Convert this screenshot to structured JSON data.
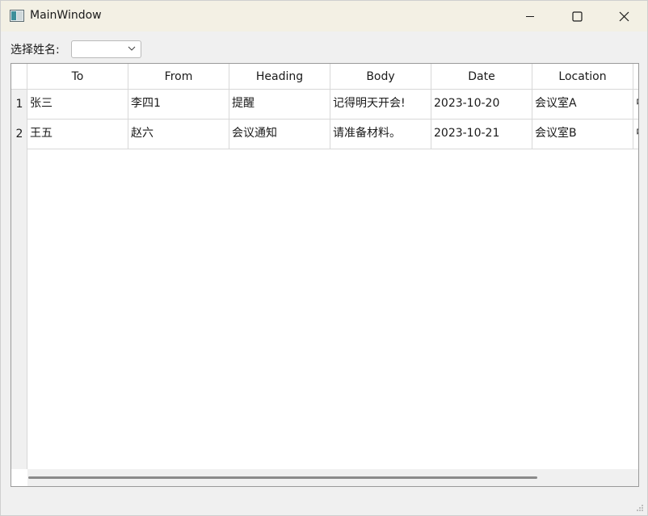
{
  "window": {
    "title": "MainWindow"
  },
  "filter": {
    "label": "选择姓名:",
    "selected": ""
  },
  "table": {
    "columns": [
      "To",
      "From",
      "Heading",
      "Body",
      "Date",
      "Location",
      ""
    ],
    "rows": [
      {
        "index": "1",
        "cells": [
          "张三",
          "李四1",
          "提醒",
          "记得明天开会!",
          "2023-10-20",
          "会议室A",
          "中"
        ]
      },
      {
        "index": "2",
        "cells": [
          "王五",
          "赵六",
          "会议通知",
          "请准备材料。",
          "2023-10-21",
          "会议室B",
          "中"
        ]
      }
    ]
  },
  "colors": {
    "titlebar": "#f3f0e4",
    "background": "#f0f0f0"
  }
}
